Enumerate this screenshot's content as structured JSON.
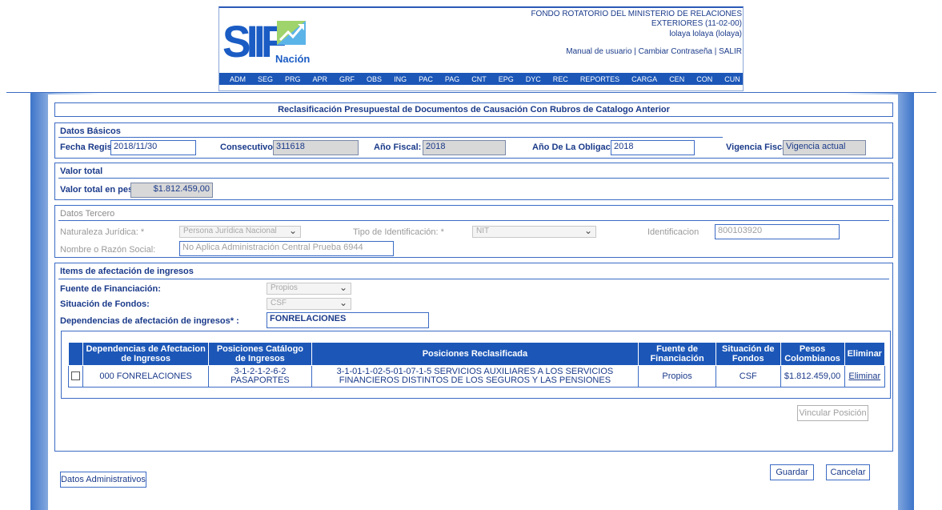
{
  "header": {
    "logo_text": "SIIF",
    "logo_sub": "Nación",
    "org_name_line1": "FONDO ROTATORIO DEL MINISTERIO DE RELACIONES",
    "org_name_line2": "EXTERIORES (11-02-00)",
    "user": "lolaya lolaya (lolaya)",
    "link_manual": "Manual de usuario",
    "link_password": "Cambiar Contraseña",
    "link_exit": "SALIR",
    "separator": " | ",
    "menu": [
      "ADM",
      "SEG",
      "PRG",
      "APR",
      "GRF",
      "OBS",
      "ING",
      "PAC",
      "PAG",
      "CNT",
      "EPG",
      "DYC",
      "REC",
      "REPORTES",
      "CARGA",
      "CEN",
      "CON",
      "CUN"
    ]
  },
  "form_title": "Reclasificación Presupuestal de Documentos de Causación Con Rubros de Catalogo Anterior",
  "datos_basicos": {
    "title": "Datos Básicos",
    "fecha_label": "Fecha Registro:",
    "fecha_value": "2018/11/30",
    "consecutivo_label": "Consecutivo:",
    "consecutivo_value": "311618",
    "anio_fiscal_label": "Año Fiscal:",
    "anio_fiscal_value": "2018",
    "anio_obligacion_label": "Año De La Obligacion:",
    "anio_obligacion_value": "2018",
    "vigencia_label": "Vigencia Fiscal:",
    "vigencia_value": "Vigencia actual"
  },
  "valor_total": {
    "title": "Valor total",
    "label": "Valor total en pesos",
    "value": "$1.812.459,00"
  },
  "datos_tercero": {
    "title": "Datos Tercero",
    "naturaleza_label": "Naturaleza Jurídica: *",
    "naturaleza_value": "Persona Jurídica Nacional",
    "tipo_id_label": "Tipo de Identificación: *",
    "tipo_id_value": "NIT",
    "identificacion_label": "Identificacion",
    "identificacion_value": "800103920",
    "nombre_label": "Nombre o Razón Social:",
    "nombre_value": "No Aplica Administración Central Prueba 6944"
  },
  "items": {
    "title": "Items de afectación de ingresos",
    "fuente_label": "Fuente de Financiación:",
    "fuente_value": "Propios",
    "situacion_label": "Situación de Fondos:",
    "situacion_value": "CSF",
    "dependencias_label": "Dependencias de afectación de ingresos* :",
    "dependencias_value": "FONRELACIONES"
  },
  "table": {
    "headers": [
      "",
      "Dependencias de Afectacion de Ingresos",
      "Posiciones Catálogo de Ingresos",
      "Posiciones Reclasificada",
      "Fuente de Financiación",
      "Situación de Fondos",
      "Pesos Colombianos",
      "Eliminar"
    ],
    "rows": [
      {
        "dependencia": "000 FONRELACIONES",
        "posicion": "3-1-2-1-2-6-2 PASAPORTES",
        "reclasificada": "3-1-01-1-02-5-01-07-1-5 SERVICIOS AUXILIARES A LOS SERVICIOS FINANCIEROS DISTINTOS DE LOS SEGUROS Y LAS PENSIONES",
        "fuente": "Propios",
        "situacion": "CSF",
        "pesos": "$1.812.459,00",
        "eliminar": "Eliminar"
      }
    ]
  },
  "buttons": {
    "vincular": "Vincular Posición",
    "guardar": "Guardar",
    "cancelar": "Cancelar",
    "datos_admin": "Datos Administrativos"
  },
  "colors": {
    "primary": "#1c57b8",
    "text": "#1a3a8a",
    "border": "#3b6bc4"
  }
}
